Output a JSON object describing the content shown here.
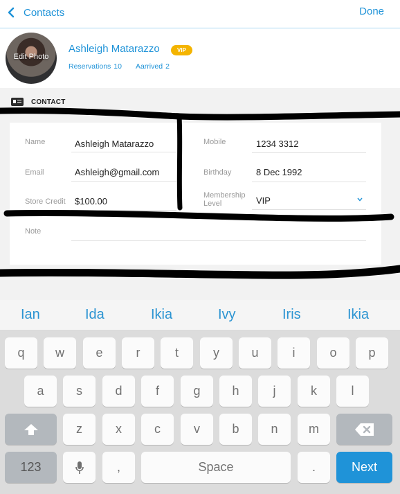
{
  "nav": {
    "back_label": "Contacts",
    "done_label": "Done",
    "back_icon": "chevron-left-icon"
  },
  "profile": {
    "avatar_caption": "Edit Photo",
    "name": "Ashleigh Matarazzo",
    "badge": "VIP",
    "reservations_label": "Reservations",
    "reservations_count": "10",
    "arrived_label": "Aarrived",
    "arrived_count": "2"
  },
  "section": {
    "title": "CONTACT",
    "icon": "contact-card-icon"
  },
  "form": {
    "name_label": "Name",
    "name_value": "Ashleigh Matarazzo",
    "email_label": "Email",
    "email_value": "Ashleigh@gmail.com",
    "store_credit_label": "Store Credit",
    "store_credit_value": "$100.00",
    "mobile_label": "Mobile",
    "mobile_value": "1234 3312",
    "birthday_label": "Birthday",
    "birthday_value": "8 Dec 1992",
    "membership_label_1": "Membership",
    "membership_label_2": "Level",
    "membership_value": "VIP",
    "note_label": "Note",
    "note_value": ""
  },
  "suggestions": [
    "Ian",
    "Ida",
    "Ikia",
    "Ivy",
    "Iris",
    "Ikia"
  ],
  "keyboard": {
    "row1": [
      "q",
      "w",
      "e",
      "r",
      "t",
      "y",
      "u",
      "i",
      "o",
      "p"
    ],
    "row2": [
      "a",
      "s",
      "d",
      "f",
      "g",
      "h",
      "j",
      "k",
      "l"
    ],
    "row3": [
      "z",
      "x",
      "c",
      "v",
      "b",
      "n",
      "m"
    ],
    "numbers_key": "123",
    "comma_key": ",",
    "space_key": "Space",
    "period_key": ".",
    "next_key": "Next",
    "shift_icon": "shift-arrow-icon",
    "delete_icon": "backspace-icon",
    "mic_icon": "microphone-icon"
  },
  "colors": {
    "accent": "#1f93d8",
    "badge": "#f4b400",
    "section_bg": "#f2f2f2",
    "keyboard_bg": "#dcdcdc"
  }
}
